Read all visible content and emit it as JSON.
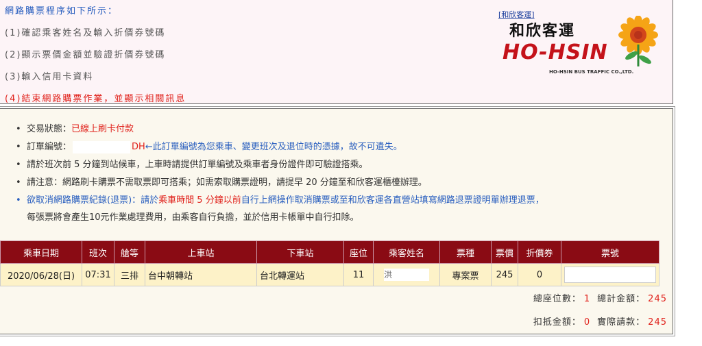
{
  "steps": {
    "heading": "網路購票程序如下所示：",
    "items": [
      "(1)確認乘客姓名及輸入折價券號碼",
      "(2)顯示票價金額並驗證折價券號碼",
      "(3)輸入信用卡資料",
      "(4)結束網路購票作業，並顯示相關訊息"
    ]
  },
  "logo": {
    "link": "[和欣客運]",
    "zh_name": "和欣客運",
    "en_name": "HO-HSIN",
    "subtitle": "HO-HSIN BUS TRAFFIC CO.,LTD."
  },
  "info": {
    "status_label": "交易狀態：",
    "status_value": "已線上刷卡付款",
    "order_label": "訂單編號：",
    "order_suffix": "DH",
    "order_note": "←此訂單編號為您乘車、變更班次及退位時的憑據，故不可遺失。",
    "boarding_note": "請於班次前 5 分鐘到站候車，上車時請提供訂單編號及乘車者身份證件即可驗證搭乘。",
    "notice": "請注意：網路刷卡購票不需取票即可搭乘；如需索取購票證明，請提早 20 分鐘至和欣客運櫃檯辦理。",
    "cancel_link": "欲取消網路購票紀錄(退票)",
    "cancel_a": "：請於",
    "cancel_red": "乘車時間 5 分鐘以前",
    "cancel_b": "自行上網操作取消購票或至和欣客運各直營站填寫網路退票證明單辦理退票，",
    "cancel_c": "每張票將會產生10元作業處理費用，由乘客自行負擔，並於信用卡帳單中自行扣除。"
  },
  "table": {
    "headers": [
      "乘車日期",
      "班次",
      "艙等",
      "上車站",
      "下車站",
      "座位",
      "乘客姓名",
      "票種",
      "票價",
      "折價券",
      "票號"
    ],
    "row": {
      "date": "2020/06/28(日)",
      "time": "07:31",
      "class": "三排",
      "from": "台中朝轉站",
      "to": "台北轉運站",
      "seat": "11",
      "passenger": "洪",
      "ticket_type": "專案票",
      "price": "245",
      "coupon": "0",
      "ticket_no": ""
    }
  },
  "totals": {
    "seats_label": "總座位數：",
    "seats": "1",
    "total_label": "總計金額：",
    "total": "245",
    "deduct_label": "扣抵金額：",
    "deduct": "0",
    "actual_label": "實際請款：",
    "actual": "245"
  },
  "colors": {
    "header_bg": "#8a0b14",
    "row_bg": "#fdf2c8",
    "accent_red": "#e0201a",
    "link_blue": "#2a5fbf"
  }
}
